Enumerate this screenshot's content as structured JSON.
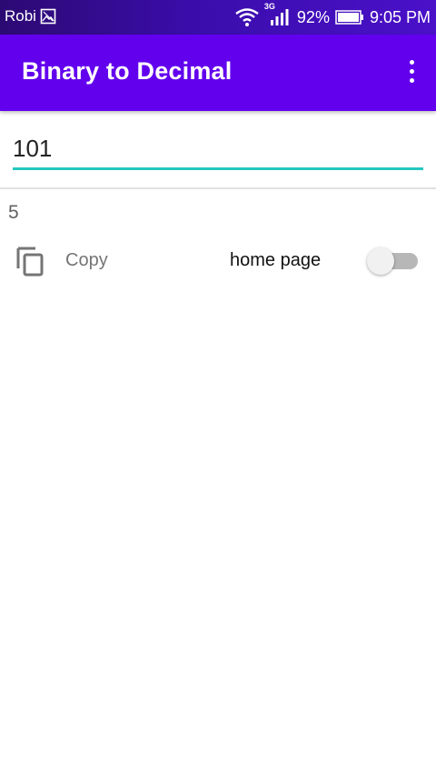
{
  "status_bar": {
    "carrier": "Robi",
    "network_type": "3G",
    "battery": "92%",
    "time": "9:05 PM",
    "icons": [
      "gallery-icon",
      "wifi-icon",
      "signal-icon",
      "battery-icon"
    ]
  },
  "app_bar": {
    "title": "Binary to Decimal",
    "menu_icon": "more-vert-icon",
    "color": "#6200ee"
  },
  "converter": {
    "input_value": "101",
    "accent_color": "#26c6c0",
    "result": "5",
    "copy_label": "Copy",
    "copy_icon": "copy-icon",
    "home_page_label": "home page",
    "home_page_toggle_on": false
  }
}
